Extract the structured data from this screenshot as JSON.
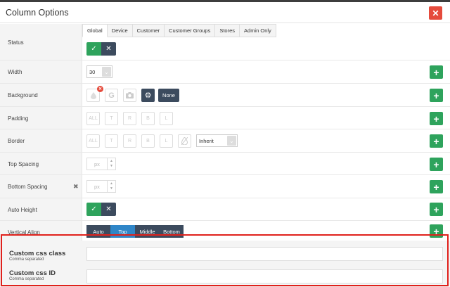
{
  "modal": {
    "title": "Column Options"
  },
  "tabs": [
    "Global",
    "Device",
    "Customer",
    "Customer Groups",
    "Stores",
    "Admin Only"
  ],
  "rows": {
    "status": "Status",
    "width": "Width",
    "background": "Background",
    "padding": "Padding",
    "border": "Border",
    "top_spacing": "Top Spacing",
    "bottom_spacing": "Bottom Spacing",
    "auto_height": "Auto Height",
    "vertical_align": "Vertical Align"
  },
  "width_value": "30",
  "background_none": "None",
  "sides": [
    "ALL",
    "T",
    "R",
    "B",
    "L"
  ],
  "border_style": "Inherit",
  "px_placeholder": "px",
  "vertical_align_options": [
    "Auto",
    "Top",
    "Middle",
    "Bottom"
  ],
  "vertical_align_selected": "Top",
  "custom_css_class": {
    "label": "Custom css class",
    "hint": "Comma separated"
  },
  "custom_css_id": {
    "label": "Custom css ID",
    "hint": "Comma separated"
  },
  "icons": {
    "close": "close-icon",
    "check": "check-icon",
    "x": "x-icon",
    "plus": "plus-icon",
    "image": "image-icon",
    "google": "google-icon",
    "camera": "camera-icon",
    "gear": "gear-icon"
  },
  "colors": {
    "green": "#2ea35c",
    "dark": "#3c4b5e",
    "blue": "#2f86c8",
    "red": "#e54b3c",
    "highlight": "#e0211c"
  }
}
